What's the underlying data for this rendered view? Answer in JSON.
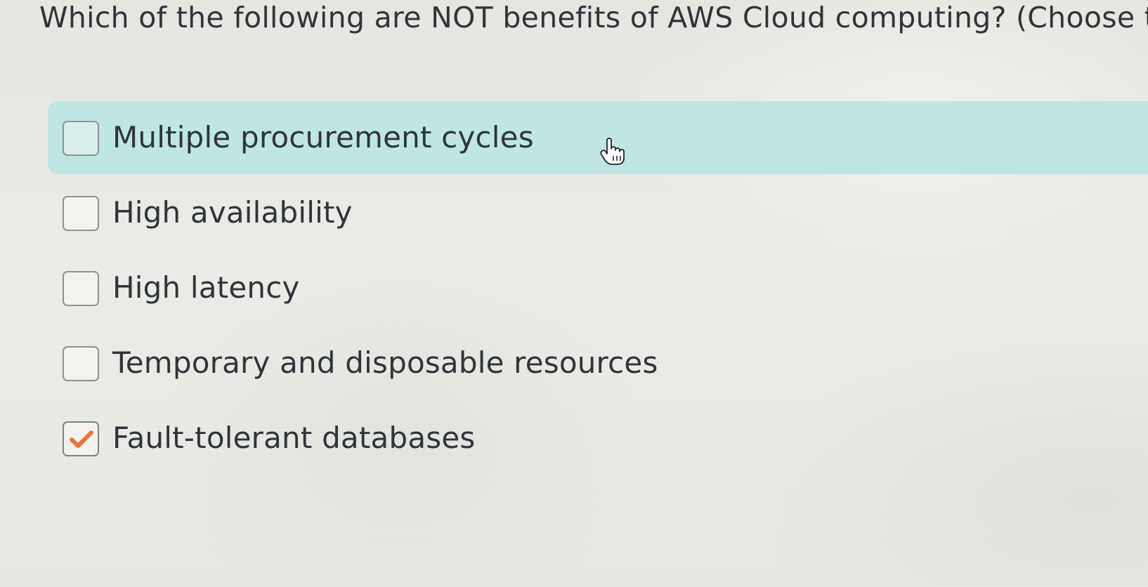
{
  "question": {
    "text": "Which of the following are NOT benefits of AWS Cloud computing? (Choose two"
  },
  "options": [
    {
      "label": "Multiple procurement cycles",
      "checked": false,
      "highlighted": true
    },
    {
      "label": "High availability",
      "checked": false,
      "highlighted": false
    },
    {
      "label": "High latency",
      "checked": false,
      "highlighted": false
    },
    {
      "label": "Temporary and disposable resources",
      "checked": false,
      "highlighted": false
    },
    {
      "label": "Fault-tolerant databases",
      "checked": true,
      "highlighted": false
    }
  ],
  "colors": {
    "highlight": "#bfe6e2",
    "checkmark": "#e8743b",
    "text": "#2f353a",
    "checkbox_border": "#8d9296"
  },
  "icons": {
    "checkmark": "checkmark-icon",
    "pointer": "hand-pointer-cursor"
  }
}
